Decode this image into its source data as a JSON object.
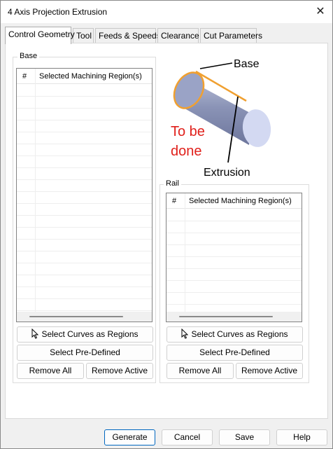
{
  "window": {
    "title": "4 Axis Projection Extrusion",
    "close_glyph": "✕"
  },
  "tabs": [
    {
      "label": "Control Geometry",
      "active": true
    },
    {
      "label": "Tool"
    },
    {
      "label": "Feeds & Speeds"
    },
    {
      "label": "Clearance"
    },
    {
      "label": "Cut Parameters"
    }
  ],
  "base_group": {
    "label": "Base",
    "list": {
      "col_num": "#",
      "col_name": "Selected Machining Region(s)"
    },
    "select_curves_label": "Select Curves as Regions",
    "select_predefined_label": "Select Pre-Defined",
    "remove_all_label": "Remove All",
    "remove_active_label": "Remove Active"
  },
  "rail_group": {
    "label": "Rail",
    "list": {
      "col_num": "#",
      "col_name": "Selected Machining Region(s)"
    },
    "select_curves_label": "Select Curves as Regions",
    "select_predefined_label": "Select Pre-Defined",
    "remove_all_label": "Remove All",
    "remove_active_label": "Remove Active"
  },
  "illustration": {
    "base_label": "Base",
    "extrusion_label": "Extrusion",
    "todo_line1": "To be",
    "todo_line2": "done",
    "colors": {
      "todo": "#e0201b",
      "outline": "#f0a030",
      "cylinder": "#8c95b8"
    }
  },
  "footer": {
    "generate_label": "Generate",
    "cancel_label": "Cancel",
    "save_label": "Save",
    "help_label": "Help"
  }
}
